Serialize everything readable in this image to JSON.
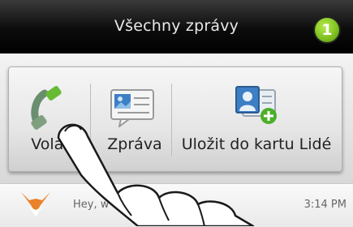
{
  "header": {
    "title": "Všechny zprávy",
    "badge_count": "1",
    "badge_color": "#7cbf1e"
  },
  "actions": [
    {
      "label": "Volat",
      "icon": "phone-icon"
    },
    {
      "label": "Zpráva",
      "icon": "message-icon"
    },
    {
      "label": "Uložit do kartu Lidé",
      "icon": "save-contact-icon"
    }
  ],
  "list": {
    "preview": "Hey, w",
    "time": "3:14 PM"
  },
  "colors": {
    "accent": "#7cbf1e",
    "title_bar": "#000000"
  }
}
